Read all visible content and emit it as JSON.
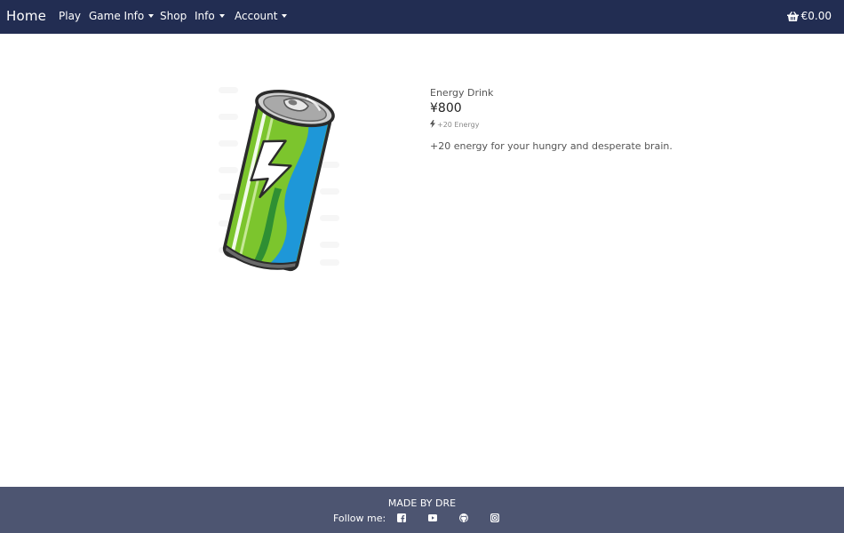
{
  "nav": {
    "brand": "Home",
    "items": [
      {
        "label": "Play",
        "dropdown": false
      },
      {
        "label": "Game Info",
        "dropdown": true
      },
      {
        "label": "Shop",
        "dropdown": false
      },
      {
        "label": "Info",
        "dropdown": true
      },
      {
        "label": "Account",
        "dropdown": true
      }
    ],
    "cart_icon": "basket-icon",
    "cart_total": "€0.00"
  },
  "product": {
    "image_icon": "energy-drink-can",
    "name": "Energy Drink",
    "price": "¥800",
    "tag_icon": "lightning-bolt-icon",
    "tag": "+20 Energy",
    "description": "+20 energy for your hungry and desperate brain."
  },
  "footer": {
    "made_by": "MADE BY DRE",
    "follow_label": "Follow me:",
    "socials": [
      "facebook-icon",
      "youtube-icon",
      "github-icon",
      "instagram-icon"
    ]
  },
  "colors": {
    "navbar": "#222d52",
    "footer": "#4d5571",
    "can_green": "#7cc52d",
    "can_blue": "#1e97d8"
  }
}
